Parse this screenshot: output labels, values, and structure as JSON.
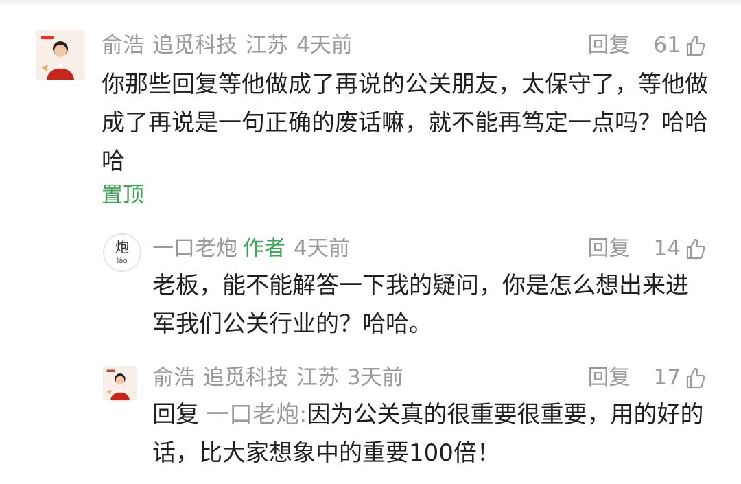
{
  "comments": [
    {
      "author": "俞浩",
      "org": "追觅科技",
      "region": "江苏",
      "time": "4天前",
      "reply_label": "回复",
      "likes": "61",
      "text": "你那些回复等他做成了再说的公关朋友，太保守了，等他做成了再说是一句正确的废话嘛，就不能再笃定一点吗？哈哈哈",
      "pinned_label": "置顶"
    },
    {
      "author": "一口老炮",
      "author_tag": "作者",
      "time": "4天前",
      "reply_label": "回复",
      "likes": "14",
      "text": "老板，能不能解答一下我的疑问，你是怎么想出来进军我们公关行业的？哈哈。"
    },
    {
      "author": "俞浩",
      "org": "追觅科技",
      "region": "江苏",
      "time": "3天前",
      "reply_label": "回复",
      "likes": "17",
      "reply_prefix": "回复",
      "reply_target": "一口老炮:",
      "text": "因为公关真的很重要很重要，用的好的话，比大家想象中的重要100倍！"
    }
  ],
  "logo": {
    "glyph": "炮",
    "subtext": "lǎo"
  },
  "icons": {
    "like": "thumbs-up-icon"
  },
  "colors": {
    "accent_green": "#3aa757",
    "meta_gray": "#9a9a9a",
    "text_dark": "#1f1f1f"
  }
}
